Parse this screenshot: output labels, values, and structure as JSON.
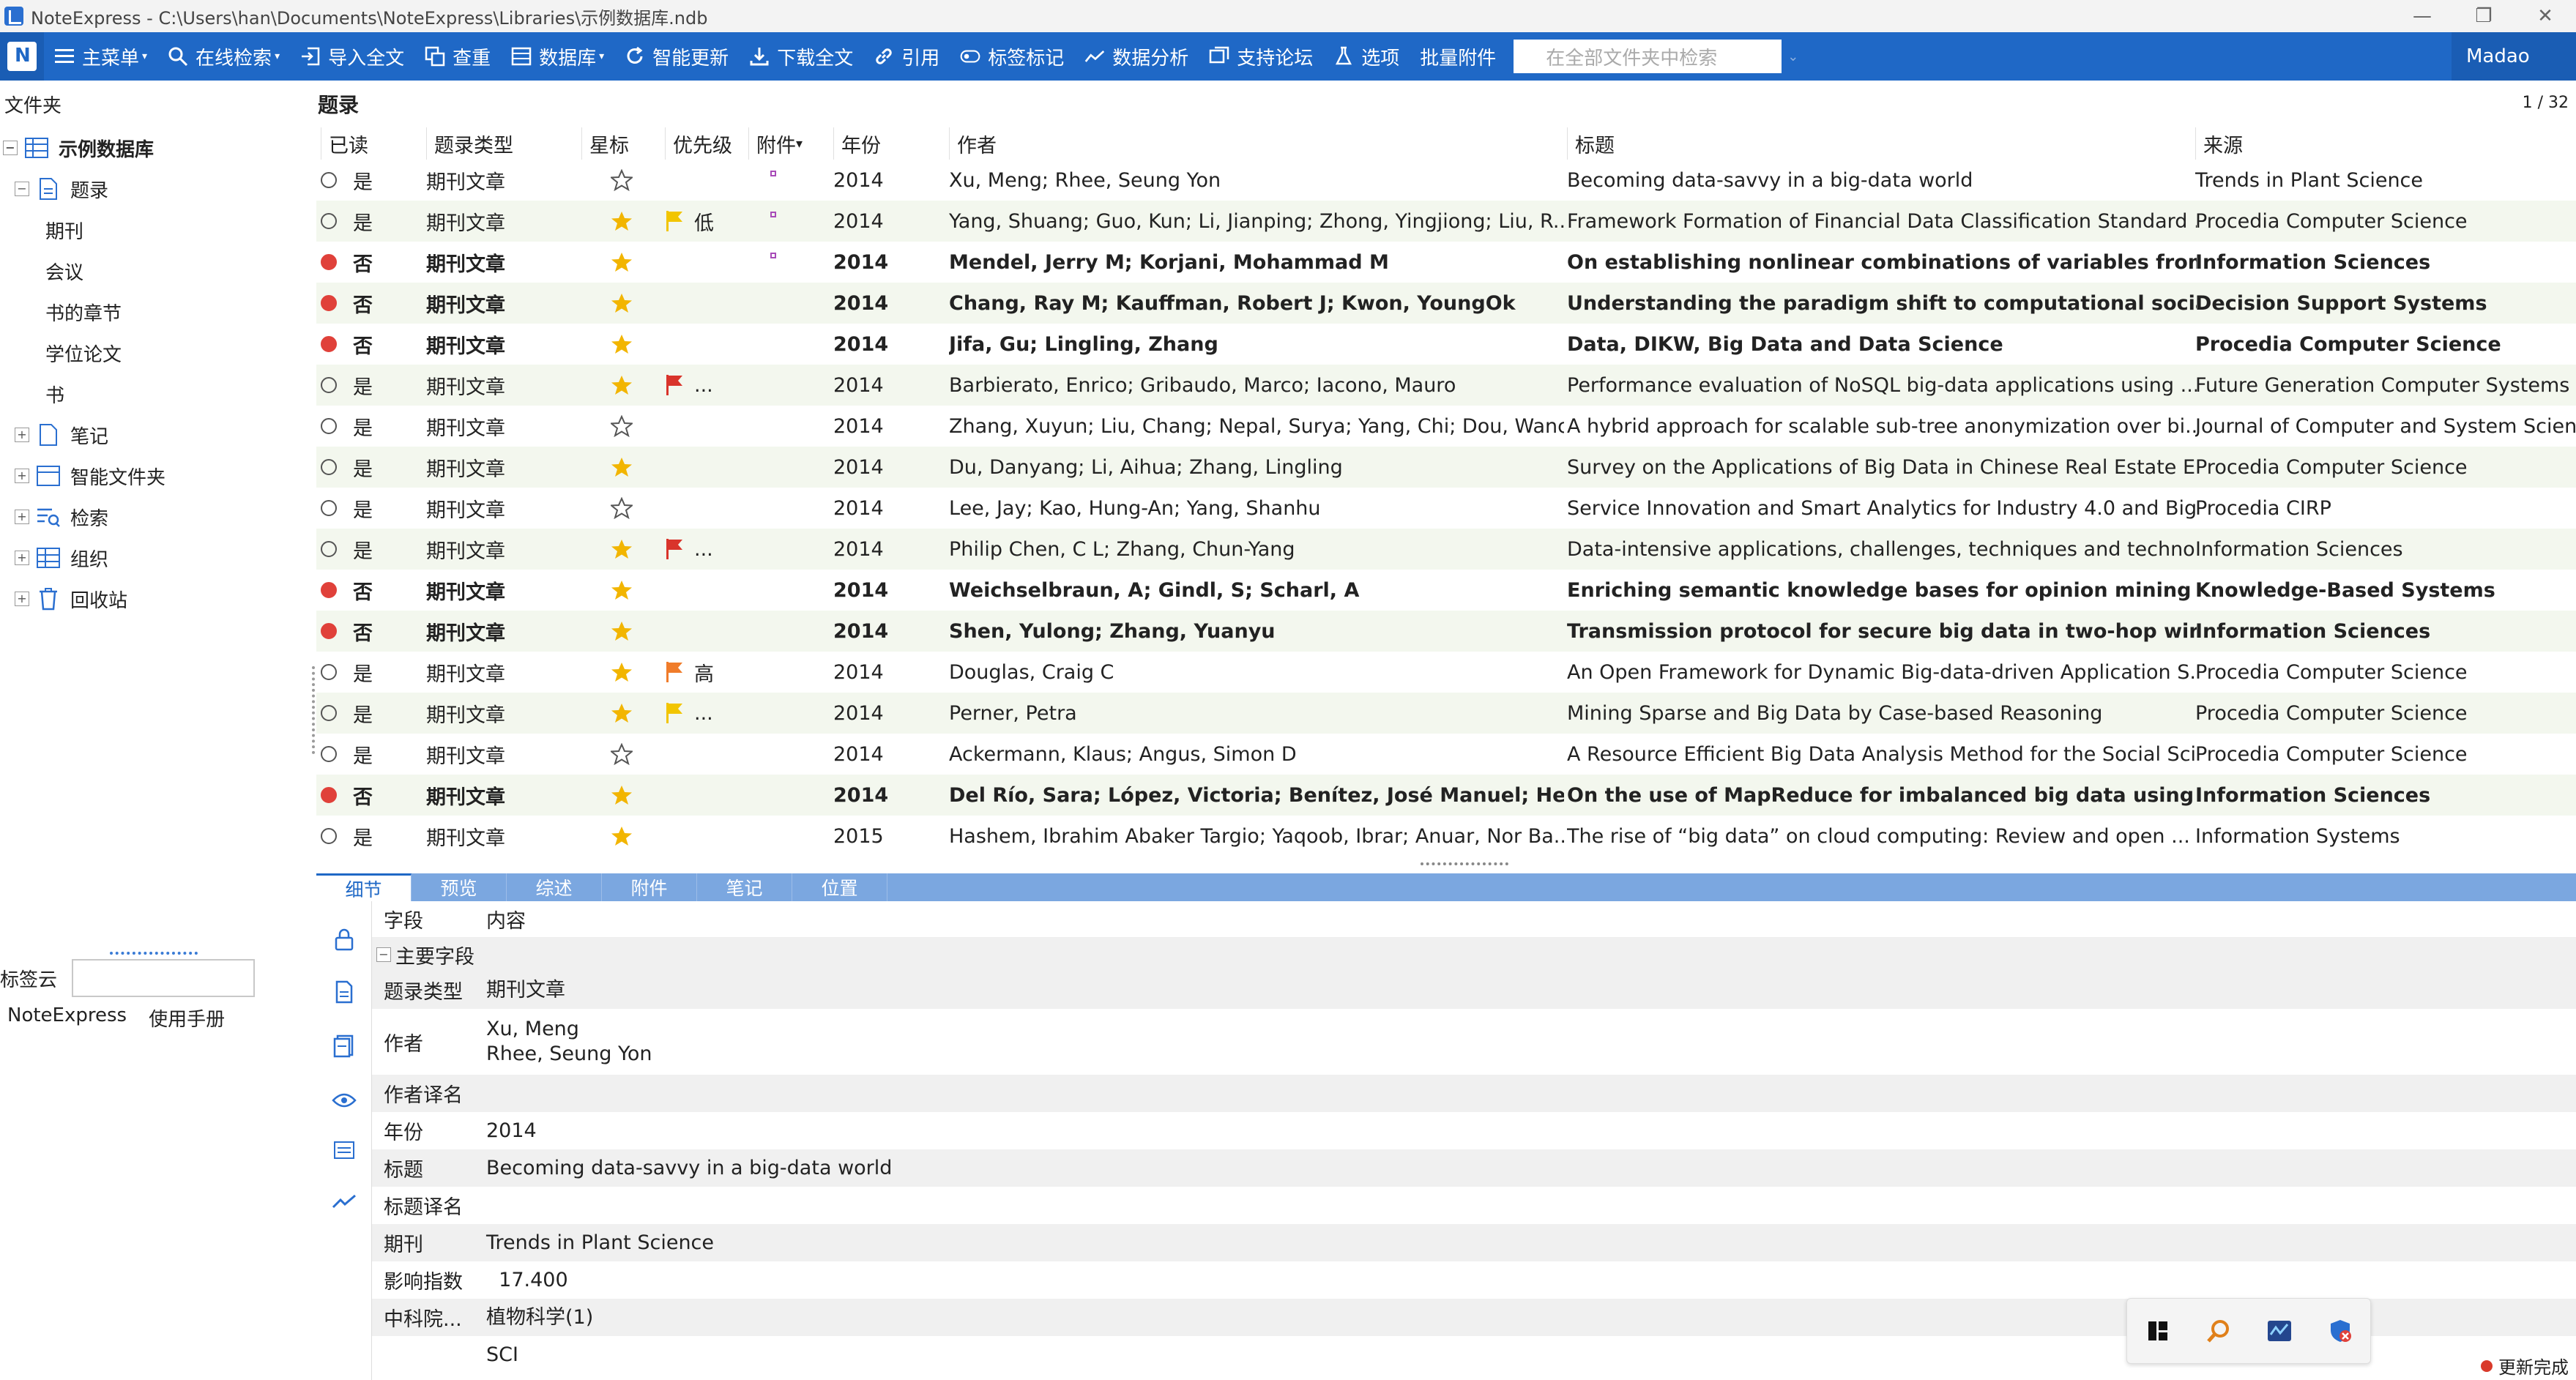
{
  "window": {
    "title": "NoteExpress - C:\\Users\\han\\Documents\\NoteExpress\\Libraries\\示例数据库.ndb",
    "controls": [
      "—",
      "❐",
      "✕"
    ]
  },
  "toolbar": {
    "items": [
      {
        "label": "主菜单",
        "icon": "menu-icon",
        "caret": true
      },
      {
        "label": "在线检索",
        "icon": "search-icon",
        "caret": true
      },
      {
        "label": "导入全文",
        "icon": "import-icon",
        "caret": false
      },
      {
        "label": "查重",
        "icon": "duplicate-icon",
        "caret": false
      },
      {
        "label": "数据库",
        "icon": "database-icon",
        "caret": true
      },
      {
        "label": "智能更新",
        "icon": "refresh-icon",
        "caret": false
      },
      {
        "label": "下载全文",
        "icon": "download-icon",
        "caret": false
      },
      {
        "label": "引用",
        "icon": "link-icon",
        "caret": false
      },
      {
        "label": "标签标记",
        "icon": "tag-icon",
        "caret": false
      },
      {
        "label": "数据分析",
        "icon": "chart-icon",
        "caret": false
      },
      {
        "label": "支持论坛",
        "icon": "forum-icon",
        "caret": false
      },
      {
        "label": "选项",
        "icon": "options-icon",
        "caret": false
      },
      {
        "label": "批量附件",
        "icon": "",
        "caret": false
      }
    ],
    "search_placeholder": "在全部文件夹中检索",
    "user": "Madao"
  },
  "sidebar": {
    "header": "文件夹",
    "tree": [
      {
        "label": "示例数据库",
        "level": 0,
        "expander": "−",
        "icon": "database-icon",
        "bold": true
      },
      {
        "label": "题录",
        "level": 1,
        "expander": "−",
        "icon": "document-icon",
        "bold": false
      },
      {
        "label": "期刊",
        "level": 2,
        "expander": "",
        "icon": "",
        "bold": false
      },
      {
        "label": "会议",
        "level": 2,
        "expander": "",
        "icon": "",
        "bold": false
      },
      {
        "label": "书的章节",
        "level": 2,
        "expander": "",
        "icon": "",
        "bold": false
      },
      {
        "label": "学位论文",
        "level": 2,
        "expander": "",
        "icon": "",
        "bold": false
      },
      {
        "label": "书",
        "level": 2,
        "expander": "",
        "icon": "",
        "bold": false
      },
      {
        "label": "笔记",
        "level": 1,
        "expander": "+",
        "icon": "note-icon",
        "bold": false
      },
      {
        "label": "智能文件夹",
        "level": 1,
        "expander": "+",
        "icon": "smart-folder-icon",
        "bold": false
      },
      {
        "label": "检索",
        "level": 1,
        "expander": "+",
        "icon": "search-list-icon",
        "bold": false
      },
      {
        "label": "组织",
        "level": 1,
        "expander": "+",
        "icon": "organize-icon",
        "bold": false
      },
      {
        "label": "回收站",
        "level": 1,
        "expander": "+",
        "icon": "trash-icon",
        "bold": false
      }
    ],
    "tagcloud_label": "标签云",
    "links": [
      "NoteExpress",
      "使用手册"
    ]
  },
  "list": {
    "title": "题录",
    "page": "1 / 32",
    "columns": [
      "已读",
      "题录类型",
      "星标",
      "优先级",
      "附件",
      "年份",
      "作者",
      "标题",
      "来源"
    ],
    "rows": [
      {
        "read": "是",
        "unread": false,
        "type": "期刊文章",
        "star": false,
        "flag": "",
        "prio": "",
        "att": true,
        "year": "2014",
        "author": "Xu, Meng; Rhee, Seung Yon",
        "title": "Becoming data-savvy in a big-data world",
        "source": "Trends in Plant Science"
      },
      {
        "read": "是",
        "unread": false,
        "type": "期刊文章",
        "star": true,
        "flag": "#f2c500",
        "prio": "低",
        "att": true,
        "year": "2014",
        "author": "Yang, Shuang; Guo, Kun; Li, Jianping; Zhong, Yingjiong; Liu, R...",
        "title": "Framework Formation of Financial Data Classification Standard ...",
        "source": "Procedia Computer Science"
      },
      {
        "read": "否",
        "unread": true,
        "type": "期刊文章",
        "star": true,
        "flag": "",
        "prio": "",
        "att": true,
        "year": "2014",
        "author": "Mendel, Jerry M; Korjani, Mohammad M",
        "title": "On establishing nonlinear combinations of variables from sma",
        "source": "Information Sciences"
      },
      {
        "read": "否",
        "unread": true,
        "type": "期刊文章",
        "star": true,
        "flag": "",
        "prio": "",
        "att": false,
        "year": "2014",
        "author": "Chang, Ray M; Kauffman, Robert J; Kwon, YoungOk",
        "title": "Understanding the paradigm shift to computational social scie",
        "source": "Decision Support Systems"
      },
      {
        "read": "否",
        "unread": true,
        "type": "期刊文章",
        "star": true,
        "flag": "",
        "prio": "",
        "att": false,
        "year": "2014",
        "author": "Jifa, Gu; Lingling, Zhang",
        "title": "Data, DIKW, Big Data and Data Science",
        "source": "Procedia Computer Science"
      },
      {
        "read": "是",
        "unread": false,
        "type": "期刊文章",
        "star": true,
        "flag": "#d9342b",
        "prio": "...",
        "att": false,
        "year": "2014",
        "author": "Barbierato, Enrico; Gribaudo, Marco; Iacono, Mauro",
        "title": "Performance evaluation of NoSQL big-data applications using ...",
        "source": "Future Generation Computer Systems"
      },
      {
        "read": "是",
        "unread": false,
        "type": "期刊文章",
        "star": false,
        "flag": "",
        "prio": "",
        "att": false,
        "year": "2014",
        "author": "Zhang, Xuyun; Liu, Chang; Nepal, Surya; Yang, Chi; Dou, Wanc...",
        "title": "A hybrid approach for scalable sub-tree anonymization over bi...",
        "source": "Journal of Computer and System Scien..."
      },
      {
        "read": "是",
        "unread": false,
        "type": "期刊文章",
        "star": true,
        "flag": "",
        "prio": "",
        "att": false,
        "year": "2014",
        "author": "Du, Danyang; Li, Aihua; Zhang, Lingling",
        "title": "Survey on the Applications of Big Data in Chinese Real Estate E...",
        "source": "Procedia Computer Science"
      },
      {
        "read": "是",
        "unread": false,
        "type": "期刊文章",
        "star": false,
        "flag": "",
        "prio": "",
        "att": false,
        "year": "2014",
        "author": "Lee, Jay; Kao, Hung-An; Yang, Shanhu",
        "title": "Service Innovation and Smart Analytics for Industry 4.0 and Big...",
        "source": "Procedia CIRP"
      },
      {
        "read": "是",
        "unread": false,
        "type": "期刊文章",
        "star": true,
        "flag": "#d9342b",
        "prio": "...",
        "att": false,
        "year": "2014",
        "author": "Philip Chen, C L; Zhang, Chun-Yang",
        "title": "Data-intensive applications, challenges, techniques and techno...",
        "source": "Information Sciences"
      },
      {
        "read": "否",
        "unread": true,
        "type": "期刊文章",
        "star": true,
        "flag": "",
        "prio": "",
        "att": false,
        "year": "2014",
        "author": "Weichselbraun, A; Gindl, S; Scharl, A",
        "title": "Enriching semantic knowledge bases for opinion mining in big",
        "source": "Knowledge-Based Systems"
      },
      {
        "read": "否",
        "unread": true,
        "type": "期刊文章",
        "star": true,
        "flag": "",
        "prio": "",
        "att": false,
        "year": "2014",
        "author": "Shen, Yulong; Zhang, Yuanyu",
        "title": "Transmission protocol for secure big data in two-hop wireless",
        "source": "Information Sciences"
      },
      {
        "read": "是",
        "unread": false,
        "type": "期刊文章",
        "star": true,
        "flag": "#f07c2a",
        "prio": "高",
        "att": false,
        "year": "2014",
        "author": "Douglas, Craig C",
        "title": "An Open Framework for Dynamic Big-data-driven Application S...",
        "source": "Procedia Computer Science"
      },
      {
        "read": "是",
        "unread": false,
        "type": "期刊文章",
        "star": true,
        "flag": "#f2c500",
        "prio": "...",
        "att": false,
        "year": "2014",
        "author": "Perner, Petra",
        "title": "Mining Sparse and Big Data by Case-based Reasoning",
        "source": "Procedia Computer Science"
      },
      {
        "read": "是",
        "unread": false,
        "type": "期刊文章",
        "star": false,
        "flag": "",
        "prio": "",
        "att": false,
        "year": "2014",
        "author": "Ackermann, Klaus; Angus, Simon D",
        "title": "A Resource Efficient Big Data Analysis Method for the Social Sci...",
        "source": "Procedia Computer Science"
      },
      {
        "read": "否",
        "unread": true,
        "type": "期刊文章",
        "star": true,
        "flag": "",
        "prio": "",
        "att": false,
        "year": "2014",
        "author": "Del Río, Sara; López, Victoria; Benítez, José Manuel; Herrera,",
        "title": "On the use of MapReduce for imbalanced big data using Rand",
        "source": "Information Sciences"
      },
      {
        "read": "是",
        "unread": false,
        "type": "期刊文章",
        "star": true,
        "flag": "",
        "prio": "",
        "att": false,
        "year": "2015",
        "author": "Hashem, Ibrahim Abaker Targio; Yaqoob, Ibrar; Anuar, Nor Ba...",
        "title": "The rise of “big data” on cloud computing: Review and open ...",
        "source": "Information Systems"
      }
    ]
  },
  "detail": {
    "tabs": [
      "细节",
      "预览",
      "综述",
      "附件",
      "笔记",
      "位置"
    ],
    "active_tab": 0,
    "header_field": "字段",
    "header_content": "内容",
    "section": "主要字段",
    "fields": [
      {
        "k": "题录类型",
        "v": "期刊文章"
      },
      {
        "k": "作者",
        "v": "Xu, Meng\nRhee, Seung Yon"
      },
      {
        "k": "作者译名",
        "v": ""
      },
      {
        "k": "年份",
        "v": "2014"
      },
      {
        "k": "标题",
        "v": "Becoming data-savvy in a big-data world"
      },
      {
        "k": "标题译名",
        "v": ""
      },
      {
        "k": "期刊",
        "v": "Trends in Plant Science"
      },
      {
        "k": "影响指数",
        "v": "  17.400"
      },
      {
        "k": "中科院...",
        "v": "植物科学(1)"
      },
      {
        "k": "",
        "v": "SCI"
      }
    ]
  },
  "status": {
    "text": "更新完成"
  },
  "colors": {
    "toolbar": "#1f68c6",
    "unread_dot": "#e0413a",
    "star": "#f2b500",
    "stripe": "#f3f7ee"
  }
}
